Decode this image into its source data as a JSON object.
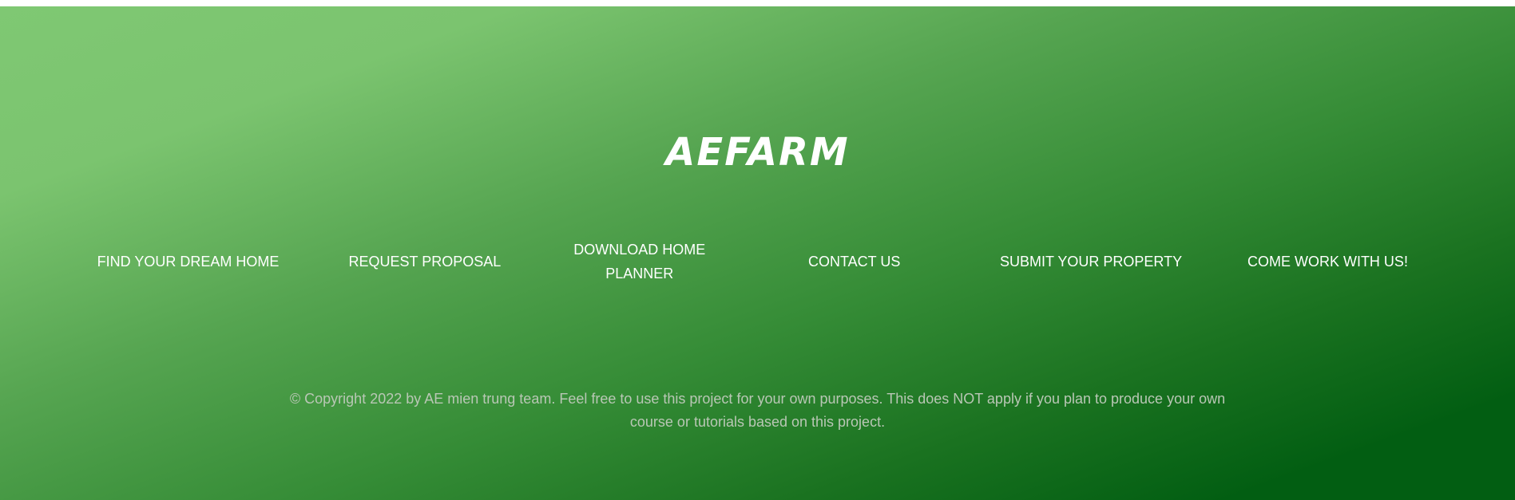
{
  "footer": {
    "brand": "AEFARM",
    "nav_items": [
      {
        "label": "FIND YOUR DREAM HOME"
      },
      {
        "label": "REQUEST PROPOSAL"
      },
      {
        "label": "DOWNLOAD HOME PLANNER"
      },
      {
        "label": "CONTACT US"
      },
      {
        "label": "SUBMIT YOUR PROPERTY"
      },
      {
        "label": "COME WORK WITH US!"
      }
    ],
    "copyright": "© Copyright 2022 by AE mien trung team. Feel free to use this project for your own purposes. This does NOT apply if you plan to produce your own course or tutorials based on this project."
  },
  "colors": {
    "gradient_light": "#7fc873",
    "gradient_dark": "#025e12",
    "nav_text": "#ffffff",
    "copyright_text": "#b9c7b5"
  }
}
